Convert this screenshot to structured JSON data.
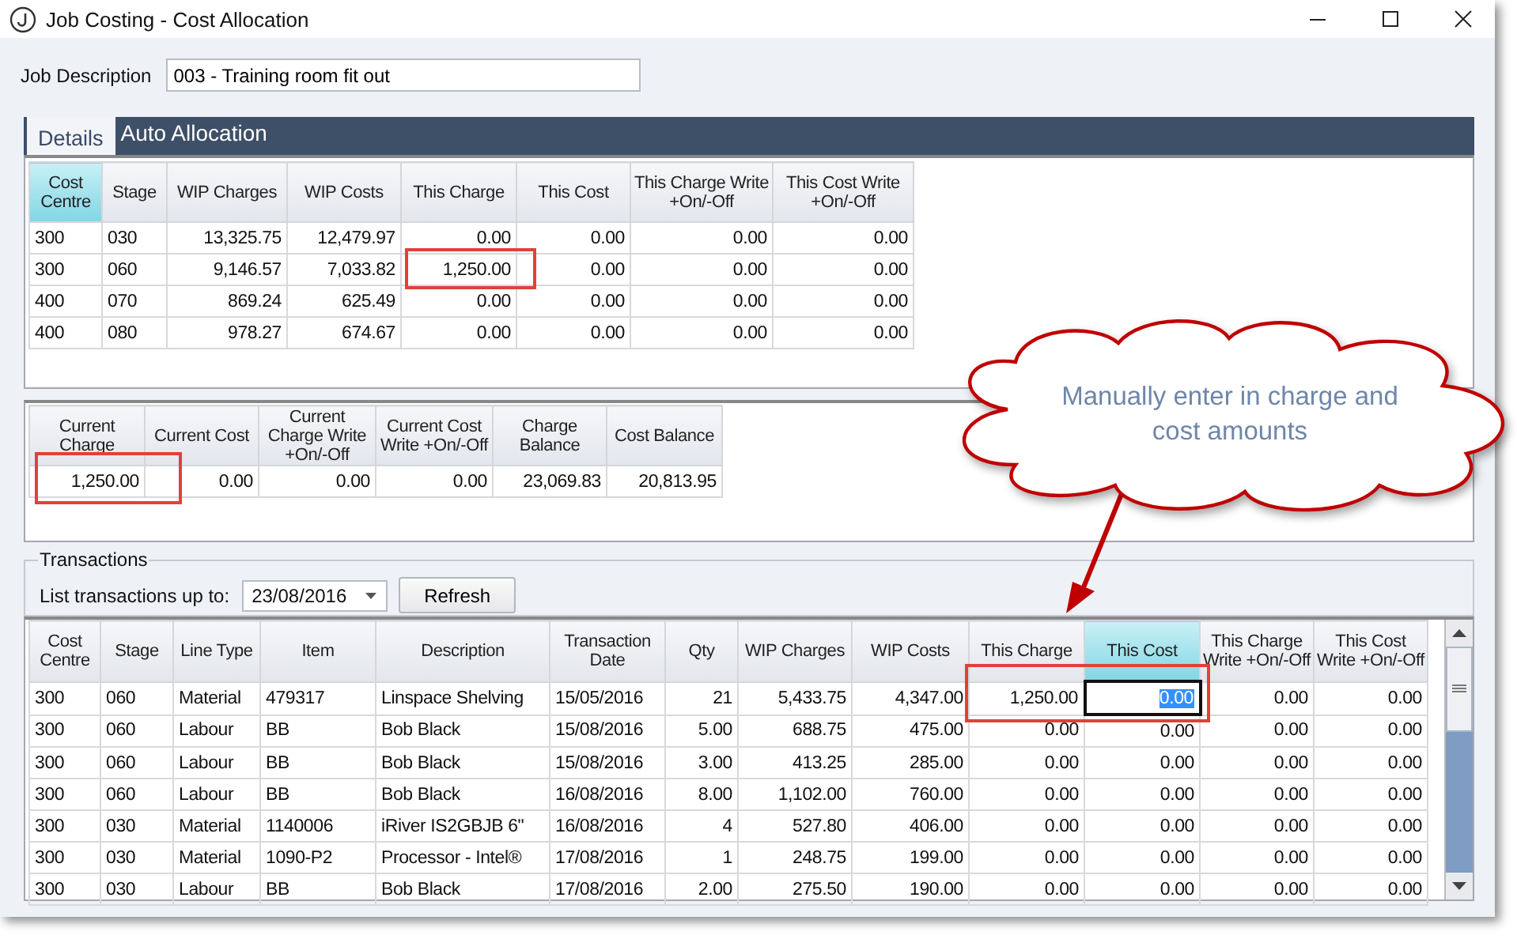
{
  "window": {
    "title": "Job Costing - Cost Allocation"
  },
  "job_description": {
    "label": "Job Description",
    "value": "003 - Training room fit out"
  },
  "tabs": [
    {
      "label": "Details",
      "selected": true
    },
    {
      "label": "Auto Allocation",
      "selected": false
    }
  ],
  "allocation_grid": {
    "columns": [
      {
        "label": "Cost Centre",
        "selected": true
      },
      {
        "label": "Stage",
        "selected": false
      },
      {
        "label": "WIP Charges",
        "selected": false
      },
      {
        "label": "WIP Costs",
        "selected": false
      },
      {
        "label": "This Charge",
        "selected": false
      },
      {
        "label": "This Cost",
        "selected": false
      },
      {
        "label": "This Charge Write +On/-Off",
        "selected": false
      },
      {
        "label": "This Cost Write +On/-Off",
        "selected": false
      }
    ],
    "rows": [
      [
        "300",
        "030",
        "13,325.75",
        "12,479.97",
        "0.00",
        "0.00",
        "0.00",
        "0.00"
      ],
      [
        "300",
        "060",
        "9,146.57",
        "7,033.82",
        "1,250.00",
        "0.00",
        "0.00",
        "0.00"
      ],
      [
        "400",
        "070",
        "869.24",
        "625.49",
        "0.00",
        "0.00",
        "0.00",
        "0.00"
      ],
      [
        "400",
        "080",
        "978.27",
        "674.67",
        "0.00",
        "0.00",
        "0.00",
        "0.00"
      ]
    ]
  },
  "totals_grid": {
    "columns": [
      "Current Charge",
      "Current Cost",
      "Current Charge Write +On/-Off",
      "Current Cost Write +On/-Off",
      "Charge Balance",
      "Cost Balance"
    ],
    "rows": [
      [
        "1,250.00",
        "0.00",
        "0.00",
        "0.00",
        "23,069.83",
        "20,813.95"
      ]
    ]
  },
  "transactions": {
    "title": "Transactions",
    "date_label": "List transactions up to:",
    "date_value": "23/08/2016",
    "refresh_button": "Refresh",
    "columns": [
      {
        "label": "Cost Centre",
        "selected": false
      },
      {
        "label": "Stage",
        "selected": false
      },
      {
        "label": "Line Type",
        "selected": false
      },
      {
        "label": "Item",
        "selected": false
      },
      {
        "label": "Description",
        "selected": false
      },
      {
        "label": "Transaction Date",
        "selected": false
      },
      {
        "label": "Qty",
        "selected": false
      },
      {
        "label": "WIP Charges",
        "selected": false
      },
      {
        "label": "WIP Costs",
        "selected": false
      },
      {
        "label": "This Charge",
        "selected": false
      },
      {
        "label": "This Cost",
        "selected": true
      },
      {
        "label": "This Charge Write +On/-Off",
        "selected": false
      },
      {
        "label": "This Cost Write +On/-Off",
        "selected": false
      }
    ],
    "rows": [
      {
        "editing": true,
        "cells": [
          "300",
          "060",
          "Material",
          "479317",
          "Linspace Shelving",
          "15/05/2016",
          "21",
          "5,433.75",
          "4,347.00",
          "1,250.00",
          "0.00",
          "0.00",
          "0.00"
        ]
      },
      {
        "editing": false,
        "cells": [
          "300",
          "060",
          "Labour",
          "BB",
          "Bob Black",
          "15/08/2016",
          "5.00",
          "688.75",
          "475.00",
          "0.00",
          "0.00",
          "0.00",
          "0.00"
        ]
      },
      {
        "editing": false,
        "cells": [
          "300",
          "060",
          "Labour",
          "BB",
          "Bob Black",
          "15/08/2016",
          "3.00",
          "413.25",
          "285.00",
          "0.00",
          "0.00",
          "0.00",
          "0.00"
        ]
      },
      {
        "editing": false,
        "cells": [
          "300",
          "060",
          "Labour",
          "BB",
          "Bob Black",
          "16/08/2016",
          "8.00",
          "1,102.00",
          "760.00",
          "0.00",
          "0.00",
          "0.00",
          "0.00"
        ]
      },
      {
        "editing": false,
        "cells": [
          "300",
          "030",
          "Material",
          "1140006",
          "iRiver IS2GBJB 6\"",
          "16/08/2016",
          "4",
          "527.80",
          "406.00",
          "0.00",
          "0.00",
          "0.00",
          "0.00"
        ]
      },
      {
        "editing": false,
        "cells": [
          "300",
          "030",
          "Material",
          "1090-P2",
          "Processor - Intel®",
          "17/08/2016",
          "1",
          "248.75",
          "199.00",
          "0.00",
          "0.00",
          "0.00",
          "0.00"
        ]
      },
      {
        "editing": false,
        "cells": [
          "300",
          "030",
          "Labour",
          "BB",
          "Bob Black",
          "17/08/2016",
          "2.00",
          "275.50",
          "190.00",
          "0.00",
          "0.00",
          "0.00",
          "0.00"
        ]
      }
    ]
  },
  "callout": {
    "text": "Manually enter in charge and cost amounts"
  }
}
